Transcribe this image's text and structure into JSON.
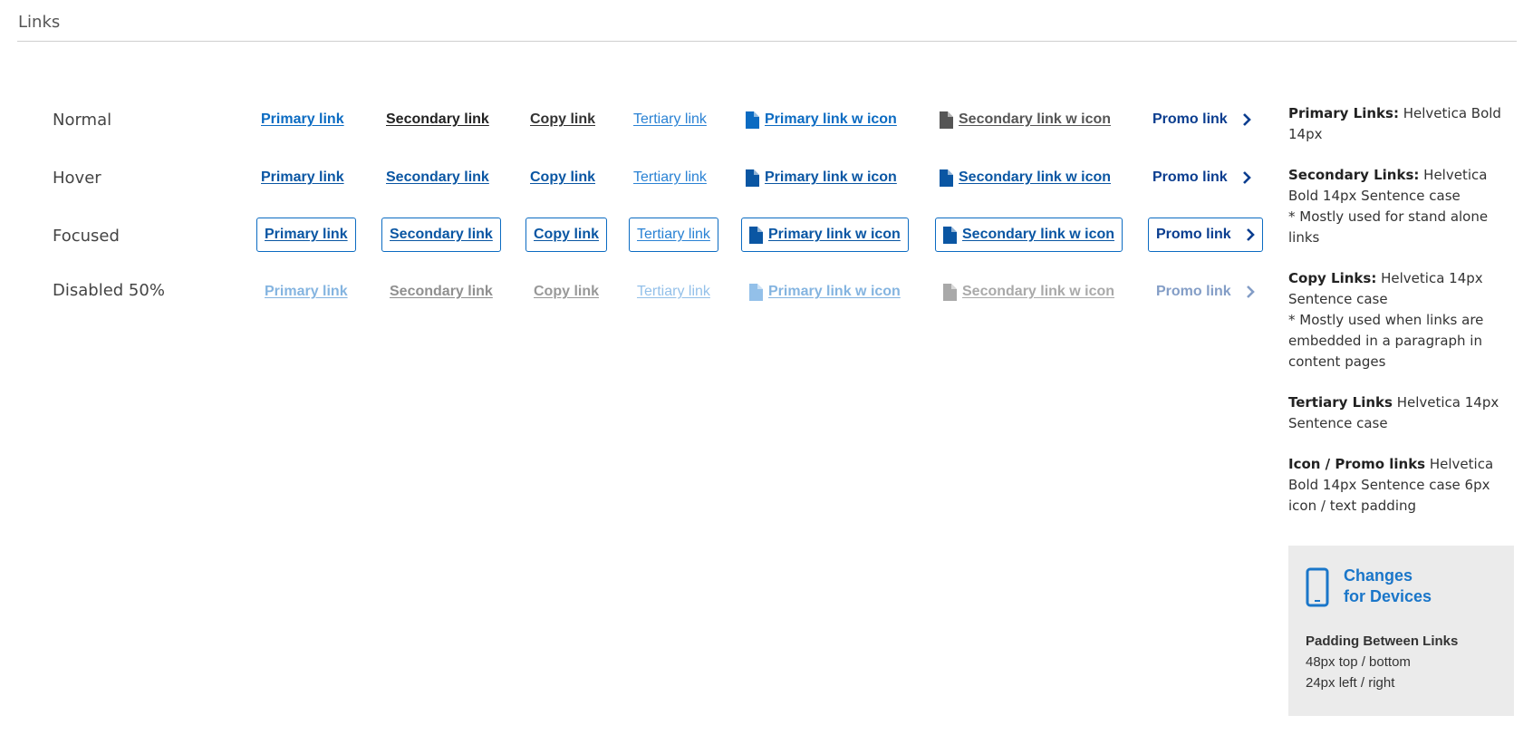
{
  "page": {
    "title": "Links"
  },
  "states": [
    "Normal",
    "Hover",
    "Focused",
    "Disabled 50%"
  ],
  "links": {
    "primary": "Primary link",
    "secondary": "Secondary link",
    "copy": "Copy link",
    "tertiary": "Tertiary link",
    "primary_icon": "Primary link w icon",
    "secondary_icon": "Secondary link w icon",
    "promo": "Promo link"
  },
  "colors": {
    "primary": "#0b6bc2",
    "primary_hover": "#0a56a3",
    "secondary": "#222222",
    "copy": "#333333",
    "tertiary": "#2a82d4",
    "icon_secondary": "#555555",
    "promo": "#0a3d8f",
    "panel_bg": "#ebebeb"
  },
  "icons": {
    "document": "document-icon",
    "chevron": "chevron-right-icon",
    "phone": "phone-icon"
  },
  "notes": [
    {
      "label": "Primary Links:",
      "text": " Helvetica Bold 14px"
    },
    {
      "label": "Secondary Links:",
      "text": " Helvetica Bold 14px  Sentence case",
      "extra": "* Mostly used for stand alone links"
    },
    {
      "label": "Copy Links:",
      "text": " Helvetica  14px Sentence case",
      "extra": "* Mostly used when links are embedded in a paragraph in content pages"
    },
    {
      "label": "Tertiary Links",
      "text": " Helvetica  14px Sentence case"
    },
    {
      "label": "Icon / Promo links",
      "text": " Helvetica Bold 14px  Sentence case 6px icon / text padding"
    }
  ],
  "devices": {
    "title_line1": "Changes",
    "title_line2": "for Devices",
    "subheading": "Padding Between Links",
    "line1": "48px top / bottom",
    "line2": "24px left / right"
  }
}
